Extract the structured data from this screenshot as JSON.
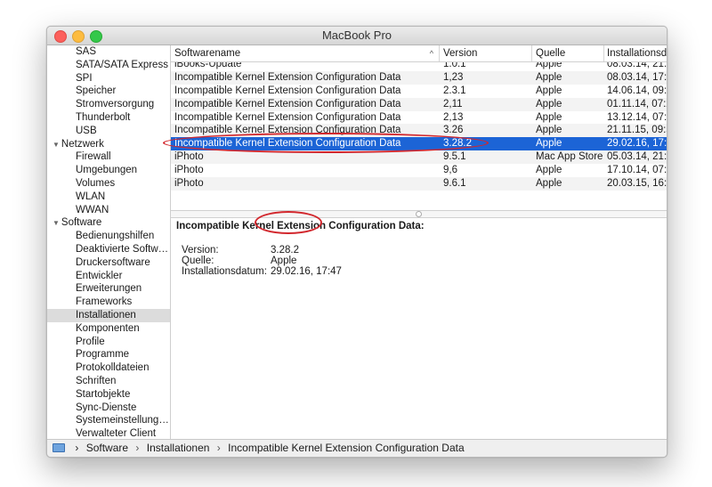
{
  "window": {
    "title": "MacBook Pro"
  },
  "sidebar": {
    "items": [
      {
        "label": "SAS",
        "level": 1
      },
      {
        "label": "SATA/SATA Express",
        "level": 1
      },
      {
        "label": "SPI",
        "level": 1
      },
      {
        "label": "Speicher",
        "level": 1
      },
      {
        "label": "Stromversorgung",
        "level": 1
      },
      {
        "label": "Thunderbolt",
        "level": 1
      },
      {
        "label": "USB",
        "level": 1
      },
      {
        "label": "Netzwerk",
        "level": 0
      },
      {
        "label": "Firewall",
        "level": 1
      },
      {
        "label": "Umgebungen",
        "level": 1
      },
      {
        "label": "Volumes",
        "level": 1
      },
      {
        "label": "WLAN",
        "level": 1
      },
      {
        "label": "WWAN",
        "level": 1
      },
      {
        "label": "Software",
        "level": 0
      },
      {
        "label": "Bedienungshilfen",
        "level": 1
      },
      {
        "label": "Deaktivierte Softw…",
        "level": 1
      },
      {
        "label": "Druckersoftware",
        "level": 1
      },
      {
        "label": "Entwickler",
        "level": 1
      },
      {
        "label": "Erweiterungen",
        "level": 1
      },
      {
        "label": "Frameworks",
        "level": 1
      },
      {
        "label": "Installationen",
        "level": 1,
        "selected": true
      },
      {
        "label": "Komponenten",
        "level": 1
      },
      {
        "label": "Profile",
        "level": 1
      },
      {
        "label": "Programme",
        "level": 1
      },
      {
        "label": "Protokolldateien",
        "level": 1
      },
      {
        "label": "Schriften",
        "level": 1
      },
      {
        "label": "Startobjekte",
        "level": 1
      },
      {
        "label": "Sync-Dienste",
        "level": 1
      },
      {
        "label": "Systemeinstellungen",
        "level": 1
      },
      {
        "label": "Verwalteter Client",
        "level": 1
      }
    ]
  },
  "table": {
    "columns": [
      "Softwarename",
      "Version",
      "Quelle",
      "Installationsda"
    ],
    "sort_indicator": "^",
    "rows": [
      {
        "name": "iBooks-Update",
        "version": "1.0.1",
        "source": "Apple",
        "date": "08.03.14, 21:4"
      },
      {
        "name": "Incompatible Kernel Extension Configuration Data",
        "version": "1,23",
        "source": "Apple",
        "date": "08.03.14, 17:0"
      },
      {
        "name": "Incompatible Kernel Extension Configuration Data",
        "version": "2.3.1",
        "source": "Apple",
        "date": "14.06.14, 09:2"
      },
      {
        "name": "Incompatible Kernel Extension Configuration Data",
        "version": "2,11",
        "source": "Apple",
        "date": "01.11.14, 07:2"
      },
      {
        "name": "Incompatible Kernel Extension Configuration Data",
        "version": "2,13",
        "source": "Apple",
        "date": "13.12.14, 07:1"
      },
      {
        "name": "Incompatible Kernel Extension Configuration Data",
        "version": "3.26",
        "source": "Apple",
        "date": "21.11.15, 09:5"
      },
      {
        "name": "Incompatible Kernel Extension Configuration Data",
        "version": "3.28.2",
        "source": "Apple",
        "date": "29.02.16, 17:4",
        "selected": true
      },
      {
        "name": "iPhoto",
        "version": "9.5.1",
        "source": "Mac App Store",
        "date": "05.03.14, 21:5"
      },
      {
        "name": "iPhoto",
        "version": "9,6",
        "source": "Apple",
        "date": "17.10.14, 07:0"
      },
      {
        "name": "iPhoto",
        "version": "9.6.1",
        "source": "Apple",
        "date": "20.03.15, 16:3"
      }
    ]
  },
  "detail": {
    "title": "Incompatible Kernel Extension Configuration Data:",
    "fields": [
      {
        "key": "Version:",
        "value": "3.28.2"
      },
      {
        "key": "Quelle:",
        "value": "Apple"
      },
      {
        "key": "Installationsdatum:",
        "value": "29.02.16, 17:47"
      }
    ]
  },
  "pathbar": {
    "segments": [
      "Software",
      "Installationen",
      "Incompatible Kernel Extension Configuration Data"
    ],
    "separator": "›"
  },
  "colors": {
    "selection": "#1c64d6",
    "highlight_ring": "#d2272d",
    "sidebar_selected": "#dcdcdc"
  }
}
